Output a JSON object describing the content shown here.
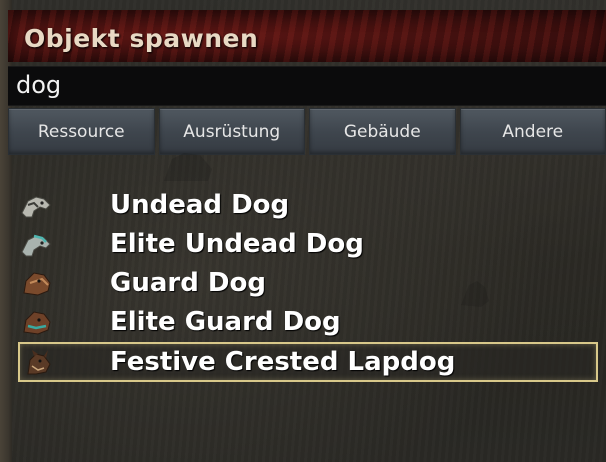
{
  "window": {
    "title": "Objekt spawnen"
  },
  "search": {
    "value": "dog"
  },
  "tabs": [
    {
      "label": "Ressource"
    },
    {
      "label": "Ausrüstung"
    },
    {
      "label": "Gebäude"
    },
    {
      "label": "Andere"
    }
  ],
  "items": [
    {
      "label": "Undead Dog",
      "icon": "undead-dog-icon"
    },
    {
      "label": "Elite Undead Dog",
      "icon": "elite-undead-dog-icon"
    },
    {
      "label": "Guard Dog",
      "icon": "guard-dog-icon"
    },
    {
      "label": "Elite Guard Dog",
      "icon": "elite-guard-dog-icon"
    },
    {
      "label": "Festive Crested Lapdog",
      "icon": "lapdog-icon",
      "selected": true
    }
  ],
  "colors": {
    "title_bg": "#3d0f0e",
    "selection_border": "#d8c88a",
    "tab_bg": "#3f464e"
  }
}
